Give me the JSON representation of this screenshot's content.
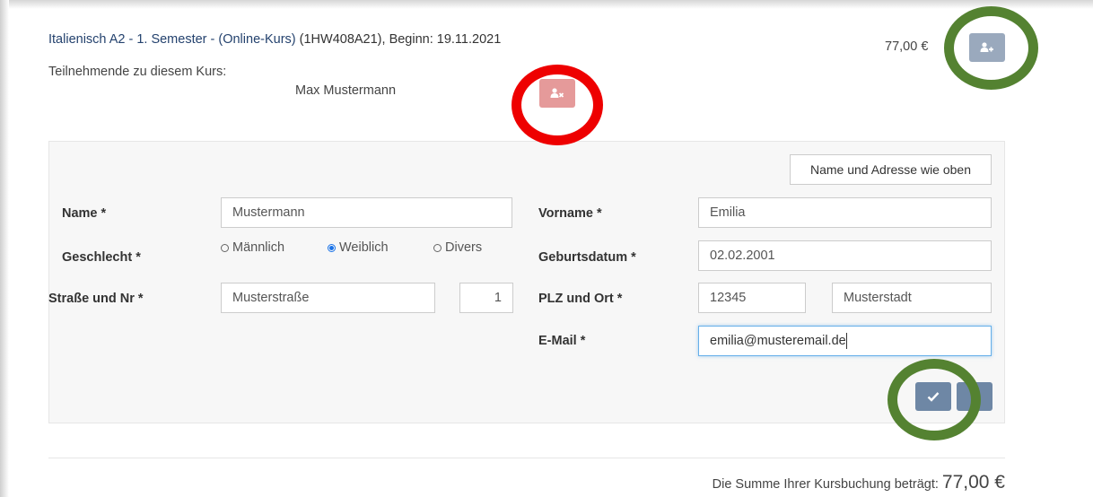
{
  "course": {
    "title_link": "Italienisch A2 - 1. Semester - (Online-Kurs)",
    "code": "(1HW408A21)",
    "start": ", Beginn: 19.11.2021",
    "price": "77,00 €",
    "participants_label": "Teilnehmende zu diesem Kurs:",
    "participant_name": "Max Mustermann"
  },
  "form": {
    "copy_address_label": "Name und Adresse wie oben",
    "name_label": "Name *",
    "name_value": "Mustermann",
    "firstname_label": "Vorname *",
    "firstname_value": "Emilia",
    "gender_label": "Geschlecht *",
    "gender_options": [
      "Männlich",
      "Weiblich",
      "Divers"
    ],
    "gender_selected": "Weiblich",
    "birthdate_label": "Geburtsdatum *",
    "birthdate_value": "02.02.2001",
    "street_label": "Straße und Nr *",
    "street_value": "Musterstraße",
    "house_number_value": "1",
    "zip_city_label": "PLZ und Ort *",
    "zip_value": "12345",
    "city_value": "Musterstadt",
    "email_label": "E-Mail *",
    "email_value": "emilia@musteremail.de"
  },
  "summary": {
    "text": "Die Summe Ihrer Kursbuchung beträgt:",
    "value": "77,00 €"
  },
  "icons": {
    "remove_participant": "user-remove-icon",
    "add_participant": "user-add-icon",
    "confirm": "check-icon",
    "more": "more-icon"
  },
  "colors": {
    "remove_button": "#e59a9a",
    "add_button": "#9aa9bd",
    "confirm_button": "#6e87a5",
    "highlight_red": "#ee0000",
    "highlight_green": "#548231",
    "link": "#24426e"
  }
}
